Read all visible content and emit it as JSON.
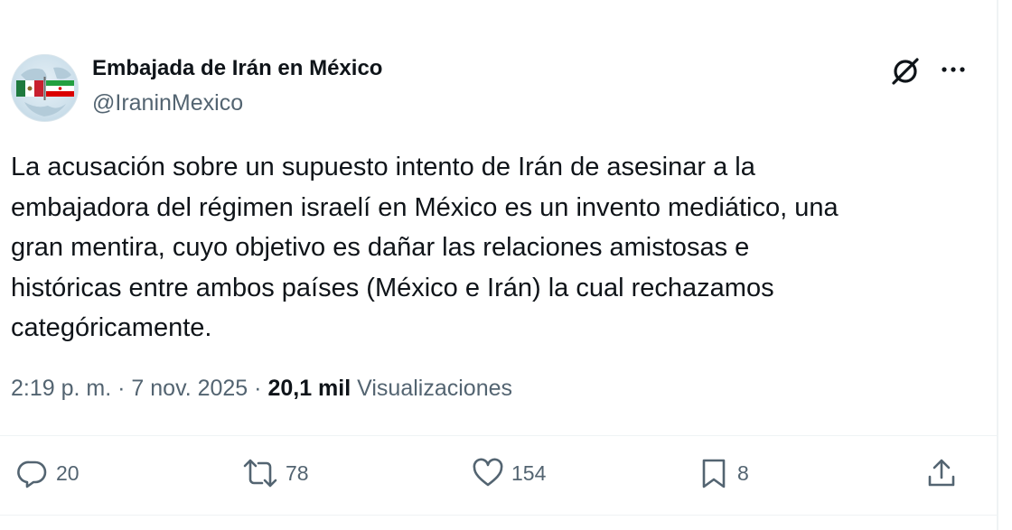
{
  "author": {
    "display_name": "Embajada de Irán en México",
    "handle": "@IraninMexico"
  },
  "tweet": {
    "text": "La acusación sobre un supuesto intento de Irán de asesinar a la\nembajadora del régimen israelí en México es un invento mediático, una\ngran mentira, cuyo objetivo es dañar las relaciones amistosas e\nhistóricas entre ambos países (México e Irán) la cual rechazamos\ncategóricamente."
  },
  "meta": {
    "time": "2:19 p. m.",
    "separator": "·",
    "date": "7 nov. 2025",
    "views_count": "20,1 mil",
    "views_label": "Visualizaciones"
  },
  "actions": {
    "replies": "20",
    "reposts": "78",
    "likes": "154",
    "bookmarks": "8"
  },
  "icons": {
    "header": [
      "grok-icon",
      "more-icon"
    ],
    "actions": [
      "reply-icon",
      "repost-icon",
      "like-icon",
      "bookmark-icon",
      "share-icon"
    ]
  },
  "colors": {
    "text_primary": "#0f1419",
    "text_secondary": "#536471",
    "divider": "#eff3f4"
  }
}
